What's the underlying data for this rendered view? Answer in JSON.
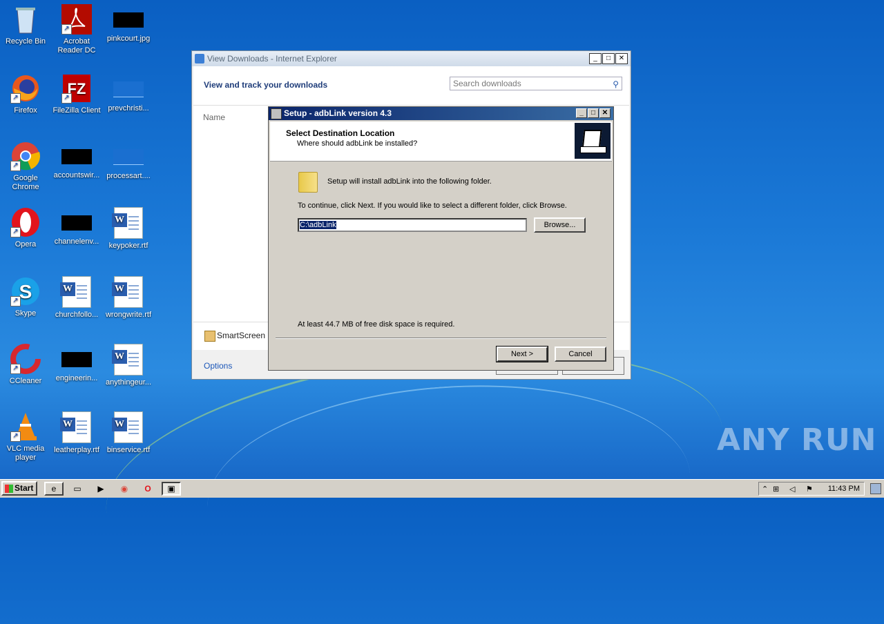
{
  "desktop": {
    "icons": [
      {
        "label": "Recycle Bin"
      },
      {
        "label": "Acrobat Reader DC"
      },
      {
        "label": "pinkcourt.jpg"
      },
      {
        "label": "Firefox"
      },
      {
        "label": "FileZilla Client"
      },
      {
        "label": "prevchristi..."
      },
      {
        "label": "Google Chrome"
      },
      {
        "label": "accountswir..."
      },
      {
        "label": "processart...."
      },
      {
        "label": "Opera"
      },
      {
        "label": "channelenv..."
      },
      {
        "label": "keypoker.rtf"
      },
      {
        "label": "Skype"
      },
      {
        "label": "churchfollo..."
      },
      {
        "label": "wrongwrite.rtf"
      },
      {
        "label": "CCleaner"
      },
      {
        "label": "engineerin..."
      },
      {
        "label": "anythingeur..."
      },
      {
        "label": "VLC media player"
      },
      {
        "label": "leatherplay.rtf"
      },
      {
        "label": "binservice.rtf"
      }
    ]
  },
  "ie_window": {
    "title": "View Downloads - Internet Explorer",
    "heading": "View and track your downloads",
    "search_placeholder": "Search downloads",
    "column_name": "Name",
    "smartscreen": "SmartScreen",
    "options": "Options"
  },
  "setup": {
    "title": "Setup - adbLink version 4.3",
    "heading": "Select Destination Location",
    "subheading": "Where should adbLink be installed?",
    "install_text": "Setup will install adbLink into the following folder.",
    "continue_text": "To continue, click Next. If you would like to select a different folder, click Browse.",
    "path": "C:\\adbLink",
    "browse": "Browse...",
    "space_text": "At least 44.7 MB of free disk space is required.",
    "next": "Next >",
    "cancel": "Cancel"
  },
  "taskbar": {
    "start": "Start",
    "clock": "11:43 PM"
  },
  "watermark": "ANY RUN"
}
